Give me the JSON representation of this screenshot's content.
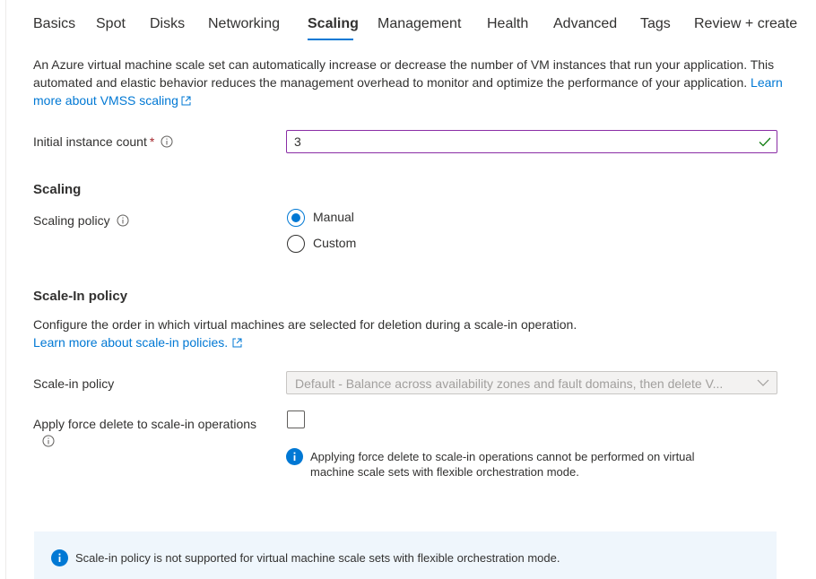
{
  "tabs": [
    {
      "label": "Basics",
      "active": false
    },
    {
      "label": "Spot",
      "active": false
    },
    {
      "label": "Disks",
      "active": false
    },
    {
      "label": "Networking",
      "active": false
    },
    {
      "label": "Scaling",
      "active": true
    },
    {
      "label": "Management",
      "active": false
    },
    {
      "label": "Health",
      "active": false
    },
    {
      "label": "Advanced",
      "active": false
    },
    {
      "label": "Tags",
      "active": false
    },
    {
      "label": "Review + create",
      "active": false
    }
  ],
  "intro": {
    "text": "An Azure virtual machine scale set can automatically increase or decrease the number of VM instances that run your application. This automated and elastic behavior reduces the management overhead to monitor and optimize the performance of your application.",
    "link": "Learn more about VMSS scaling"
  },
  "instance_count": {
    "label": "Initial instance count",
    "required_mark": "*",
    "value": "3"
  },
  "scaling": {
    "title": "Scaling",
    "policy_label": "Scaling policy",
    "options": [
      {
        "label": "Manual",
        "selected": true
      },
      {
        "label": "Custom",
        "selected": false
      }
    ]
  },
  "scale_in": {
    "title": "Scale-In policy",
    "description": "Configure the order in which virtual machines are selected for deletion during a scale-in operation.",
    "link": "Learn more about scale-in policies.",
    "policy_label": "Scale-in policy",
    "policy_value": "Default - Balance across availability zones and fault domains, then delete V...",
    "force_delete_label": "Apply force delete to scale-in operations",
    "force_delete_checked": false,
    "force_delete_note": "Applying force delete to scale-in operations cannot be performed on virtual machine scale sets with flexible orchestration mode."
  },
  "banner": {
    "text": "Scale-in policy is not supported for virtual machine scale sets with flexible orchestration mode."
  },
  "colors": {
    "accent": "#0078d4",
    "input_border": "#8a2da5",
    "valid": "#107c10",
    "banner_bg": "#eff6fc",
    "required": "#a4262c"
  }
}
